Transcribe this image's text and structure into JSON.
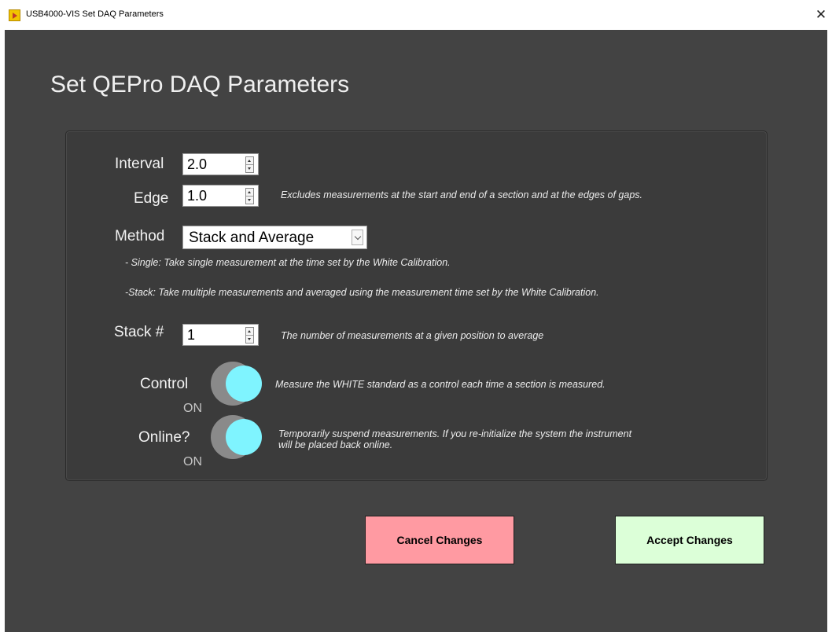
{
  "window": {
    "title": "USB4000-VIS Set DAQ Parameters",
    "close_glyph": "✕",
    "icon": "labview-app-icon"
  },
  "heading": "Set QEPro DAQ Parameters",
  "fields": {
    "interval": {
      "label": "Interval",
      "value": "2.0"
    },
    "edge": {
      "label": "Edge",
      "value": "1.0",
      "note": "Excludes measurements at the start and end of a section and at the edges of gaps."
    },
    "method": {
      "label": "Method",
      "selected": "Stack and Average",
      "note_single": "- Single: Take single measurement at the time set by the White Calibration.",
      "note_stack": "-Stack:  Take multiple measurements and averaged using the measurement time set by the White Calibration."
    },
    "stack": {
      "label": "Stack #",
      "value": "1",
      "note": "The number of measurements at a given position to average"
    },
    "control": {
      "label": "Control",
      "state": "ON",
      "note": "Measure the WHITE standard as a control each time a section is measured."
    },
    "online": {
      "label": "Online?",
      "state": "ON",
      "note_line1": "Temporarily suspend measurements. If you re-initialize the system the instrument",
      "note_line2": "will be placed back online."
    }
  },
  "buttons": {
    "cancel": "Cancel Changes",
    "accept": "Accept Changes"
  },
  "colors": {
    "background": "#434343",
    "panel": "#3b3b3b",
    "toggle_knob": "#7ff4ff",
    "cancel_button": "#ff9aa2",
    "accept_button": "#dcffd8"
  }
}
